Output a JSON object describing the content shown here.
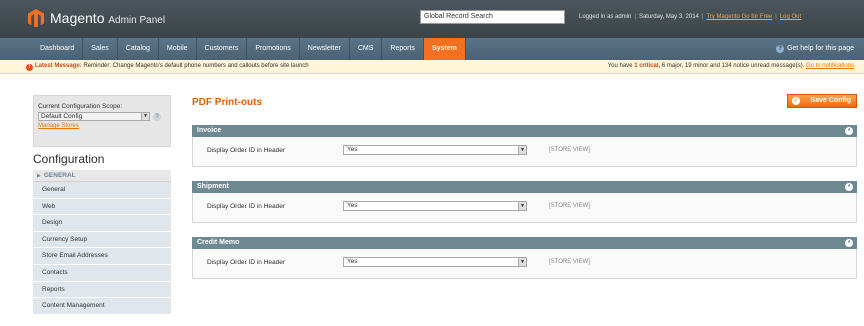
{
  "header": {
    "brand": "Magento",
    "brand_sub": "Admin Panel",
    "search_value": "Global Record Search",
    "logged_in": "Logged in as admin",
    "date": "Saturday, May 3, 2014",
    "try_link": "Try Magento Go for Free",
    "logout": "Log Out"
  },
  "nav": {
    "items": [
      "Dashboard",
      "Sales",
      "Catalog",
      "Mobile",
      "Customers",
      "Promotions",
      "Newsletter",
      "CMS",
      "Reports",
      "System"
    ],
    "active": "System",
    "help": "Get help for this page"
  },
  "message": {
    "label": "Latest Message:",
    "text": "Reminder: Change Magento's default phone numbers and callouts before site launch",
    "summary_prefix": "You have",
    "critical": "1 critical,",
    "summary_rest": "6 major, 19 minor and 134 notice unread message(s).",
    "link": "Go to notifications"
  },
  "scope": {
    "label": "Current Configuration Scope:",
    "value": "Default Config",
    "manage_stores": "Manage Stores"
  },
  "sidebar": {
    "title": "Configuration",
    "group": "GENERAL",
    "items": [
      "General",
      "Web",
      "Design",
      "Currency Setup",
      "Store Email Addresses",
      "Contacts",
      "Reports",
      "Content Management"
    ]
  },
  "page": {
    "title": "PDF Print-outs",
    "save_label": "Save Config"
  },
  "sections": [
    {
      "title": "Invoice",
      "field_label": "Display Order ID in Header",
      "value": "Yes",
      "scope": "[STORE VIEW]"
    },
    {
      "title": "Shipment",
      "field_label": "Display Order ID in Header",
      "value": "Yes",
      "scope": "[STORE VIEW]"
    },
    {
      "title": "Credit Memo",
      "field_label": "Display Order ID in Header",
      "value": "Yes",
      "scope": "[STORE VIEW]"
    }
  ],
  "colors": {
    "accent": "#f36f21",
    "nav_bg": "#4a6274",
    "section_head": "#6f8992"
  }
}
